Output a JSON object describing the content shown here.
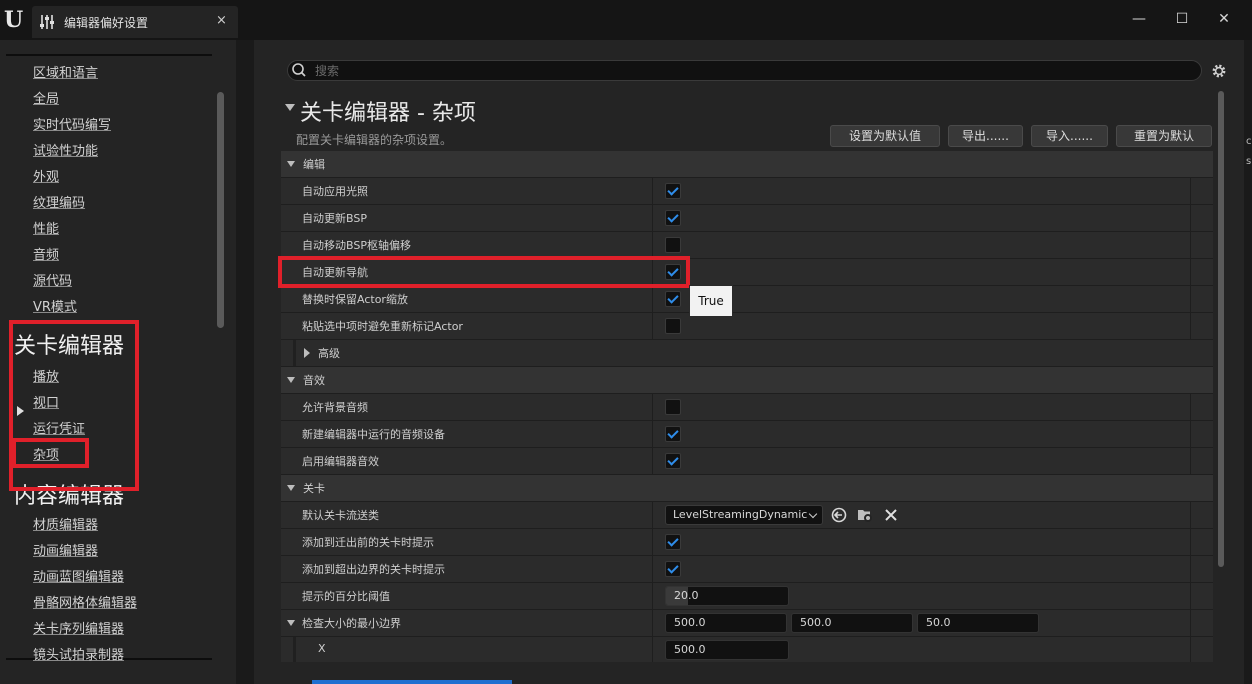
{
  "window": {
    "tab_title": "编辑器偏好设置",
    "tab_close": "×",
    "min": "—",
    "max": "☐",
    "close": "✕"
  },
  "sidebar": {
    "items_top": [
      "区域和语言",
      "全局",
      "实时代码编写",
      "试验性功能",
      "外观",
      "纹理编码",
      "性能",
      "音频",
      "源代码",
      "VR模式"
    ],
    "section_level_editor": "关卡编辑器",
    "level_items": [
      "播放",
      "视口",
      "运行凭证",
      "杂项"
    ],
    "section_content_editor": "内容编辑器",
    "content_items": [
      "材质编辑器",
      "动画编辑器",
      "动画蓝图编辑器",
      "骨骼网格体编辑器",
      "关卡序列编辑器",
      "镜头试拍录制器"
    ]
  },
  "search": {
    "placeholder": "搜索"
  },
  "page": {
    "title": "关卡编辑器 - 杂项",
    "description": "配置关卡编辑器的杂项设置。",
    "buttons": {
      "set_default": "设置为默认值",
      "export": "导出......",
      "import": "导入......",
      "reset": "重置为默认"
    }
  },
  "sections": {
    "edit": {
      "title": "编辑",
      "rows": [
        {
          "label": "自动应用光照",
          "checked": true
        },
        {
          "label": "自动更新BSP",
          "checked": true
        },
        {
          "label": "自动移动BSP枢轴偏移",
          "checked": false
        },
        {
          "label": "自动更新导航",
          "checked": true
        },
        {
          "label": "替换时保留Actor缩放",
          "checked": true
        },
        {
          "label": "粘贴选中项时避免重新标记Actor",
          "checked": false
        }
      ],
      "advanced": "高级"
    },
    "audio": {
      "title": "音效",
      "rows": [
        {
          "label": "允许背景音频",
          "checked": false
        },
        {
          "label": "新建编辑器中运行的音频设备",
          "checked": true
        },
        {
          "label": "启用编辑器音效",
          "checked": true
        }
      ]
    },
    "level": {
      "title": "关卡",
      "streaming_label": "默认关卡流送类",
      "streaming_value": "LevelStreamingDynamic",
      "prompt_move_label": "添加到迁出前的关卡时提示",
      "prompt_move_checked": true,
      "prompt_out_label": "添加到超出边界的关卡时提示",
      "prompt_out_checked": true,
      "percent_label": "提示的百分比阈值",
      "percent_value": "20.0",
      "bounds_label": "检查大小的最小边界",
      "bounds_x": "500.0",
      "bounds_y": "500.0",
      "bounds_z": "50.0",
      "x_label": "X",
      "x_value": "500.0"
    }
  },
  "tooltip": "True",
  "far_right": [
    "c",
    "s"
  ],
  "colors": {
    "accent": "#2f8dea",
    "highlight": "#e0202a"
  }
}
